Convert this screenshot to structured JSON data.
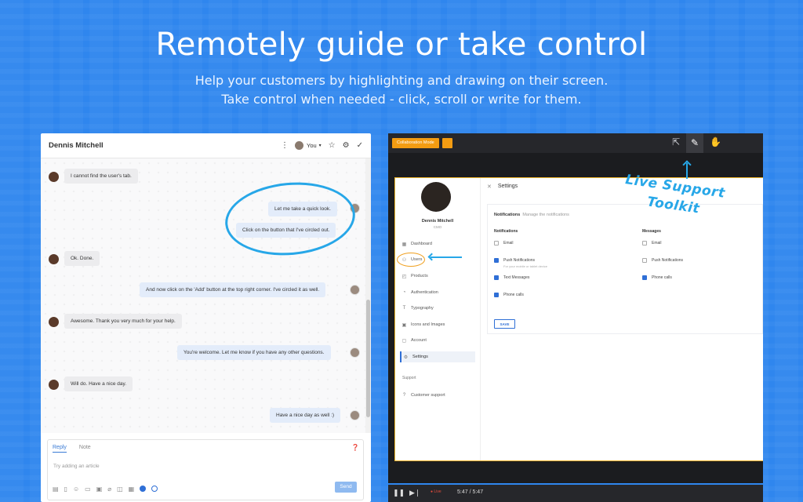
{
  "hero": {
    "title": "Remotely guide or take control",
    "sub1": "Help your customers by highlighting and drawing on their screen.",
    "sub2": "Take control when needed - click, scroll or write for them."
  },
  "chat": {
    "contact_name": "Dennis Mitchell",
    "assignee": "You",
    "messages": [
      {
        "from": "customer",
        "text": "I cannot find the user's tab."
      },
      {
        "from": "agent",
        "text": "Let me take a quick look."
      },
      {
        "from": "agent",
        "text": "Click on the button that I've circled out."
      },
      {
        "from": "customer",
        "text": "Ok. Done."
      },
      {
        "from": "agent",
        "text": "And now click on the 'Add' button at the top right corner. I've circled it as well."
      },
      {
        "from": "customer",
        "text": "Awesome. Thank you very much for your help."
      },
      {
        "from": "agent",
        "text": "You're welcome. Let me know if you have any other questions."
      },
      {
        "from": "customer",
        "text": "Will do. Have a nice day."
      },
      {
        "from": "agent",
        "text": "Have a nice day as well :)"
      }
    ],
    "reply": {
      "tab_reply": "Reply",
      "tab_note": "Note",
      "placeholder": "Try adding an article",
      "send_label": "Send"
    }
  },
  "share": {
    "collab_label": "Collaboration Mode",
    "annotation_line1": "Live Support",
    "annotation_line2": "Toolkit",
    "time": "5:47 / 5:47",
    "live_label": "Live",
    "progress": 1.0,
    "app": {
      "profile_name": "Dennis Mitchell",
      "profile_role": "CMO",
      "nav": [
        "Dashboard",
        "Users",
        "Products",
        "Authentication",
        "Typography",
        "Icons and Images",
        "Account",
        "Settings"
      ],
      "support_section": "Support",
      "support_item": "Customer support",
      "settings_title": "Settings",
      "card_title": "Notifications",
      "card_sub": "Manage the notifications",
      "col1_header": "Notifications",
      "col2_header": "Messages",
      "col1": [
        {
          "label": "Email",
          "checked": false
        },
        {
          "label": "Push Notifications",
          "checked": true,
          "sub": "For your mobile or tablet device"
        },
        {
          "label": "Text Messages",
          "checked": true
        },
        {
          "label": "Phone calls",
          "checked": true
        }
      ],
      "col2": [
        {
          "label": "Email",
          "checked": false
        },
        {
          "label": "Push Notifications",
          "checked": false
        },
        {
          "label": "Phone calls",
          "checked": true
        }
      ],
      "save_label": "SAVE"
    }
  }
}
